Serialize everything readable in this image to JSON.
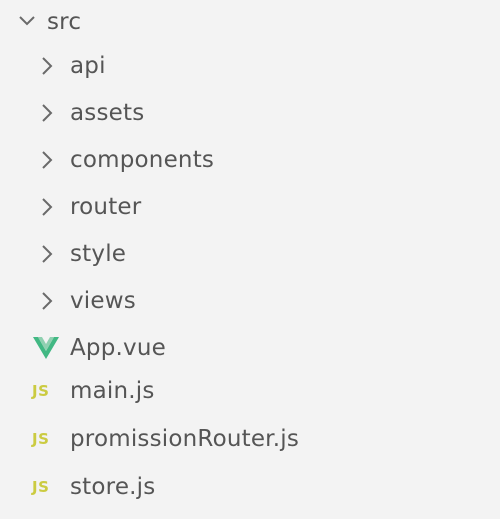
{
  "explorer": {
    "root": {
      "label": "src",
      "icon": "chevron-down-icon",
      "expanded": true
    },
    "folders": [
      {
        "label": "api",
        "icon": "chevron-right-icon"
      },
      {
        "label": "assets",
        "icon": "chevron-right-icon"
      },
      {
        "label": "components",
        "icon": "chevron-right-icon"
      },
      {
        "label": "router",
        "icon": "chevron-right-icon"
      },
      {
        "label": "style",
        "icon": "chevron-right-icon"
      },
      {
        "label": "views",
        "icon": "chevron-right-icon"
      }
    ],
    "files": [
      {
        "label": "App.vue",
        "icon": "vue-icon",
        "icon_color": "#41b883"
      },
      {
        "label": "main.js",
        "icon": "js-icon",
        "icon_text": "JS",
        "icon_color": "#cbcb41"
      },
      {
        "label": "promissionRouter.js",
        "icon": "js-icon",
        "icon_text": "JS",
        "icon_color": "#cbcb41"
      },
      {
        "label": "store.js",
        "icon": "js-icon",
        "icon_text": "JS",
        "icon_color": "#cbcb41"
      }
    ]
  }
}
